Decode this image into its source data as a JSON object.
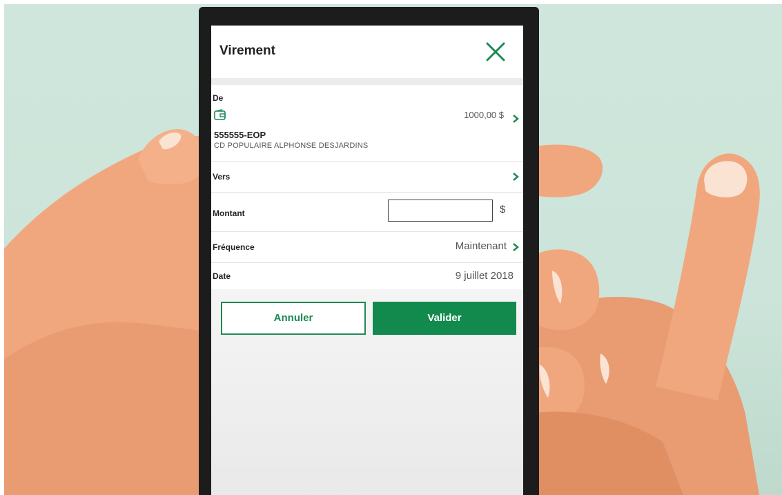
{
  "screen": {
    "title": "Virement",
    "close_icon": "close-icon"
  },
  "from": {
    "label": "De",
    "account_icon": "wallet-icon",
    "account_number": "555555-EOP",
    "institution": "CD POPULAIRE ALPHONSE DESJARDINS",
    "balance": "1000,00 $"
  },
  "to": {
    "label": "Vers"
  },
  "amount": {
    "label": "Montant",
    "value": "",
    "currency": "$"
  },
  "frequency": {
    "label": "Fréquence",
    "value": "Maintenant"
  },
  "date": {
    "label": "Date",
    "value": "9 juillet 2018"
  },
  "actions": {
    "cancel_label": "Annuler",
    "validate_label": "Valider"
  },
  "colors": {
    "brand_green": "#128a4e",
    "background": "#cfe6dc",
    "skin": "#f1a77e"
  }
}
